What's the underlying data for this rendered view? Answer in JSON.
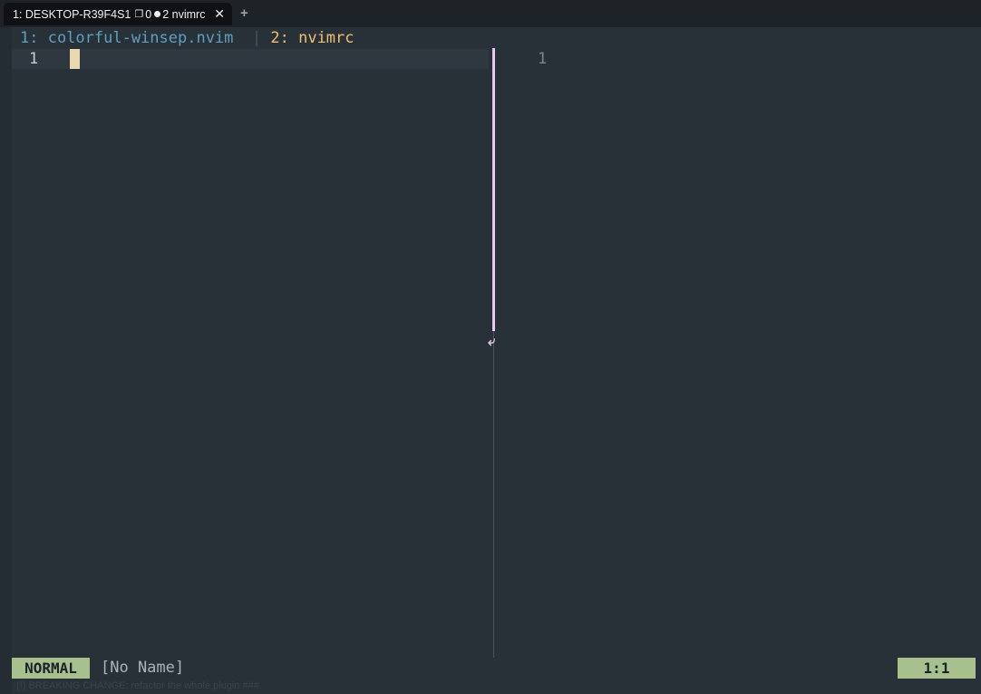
{
  "terminal": {
    "tab": {
      "title": "1: DESKTOP-R39F4S1",
      "window_glyph": "❐",
      "count": "0",
      "label": "2 nvimrc",
      "close_glyph": "✕"
    },
    "new_tab_glyph": "+"
  },
  "winbar": {
    "buffer1": "1: colorful-winsep.nvim",
    "separator": "|",
    "buffer2": "2: nvimrc"
  },
  "editor": {
    "left_window": {
      "line_number": "1"
    },
    "right_window": {
      "line_number": "1"
    },
    "separator_arrow": "⤶"
  },
  "statusline": {
    "mode": "NORMAL",
    "filename": "[No Name]",
    "position": "1:1"
  },
  "cmdline": {
    "text": "(!) BREAKING CHANGE: refactor the whole plugin ###"
  },
  "colors": {
    "background": "#283038",
    "separator_active": "#e8c8f2",
    "mode_bg": "#a8c08e",
    "winbar_active": "#f0c070",
    "winbar_inactive": "#5f9fbf"
  }
}
